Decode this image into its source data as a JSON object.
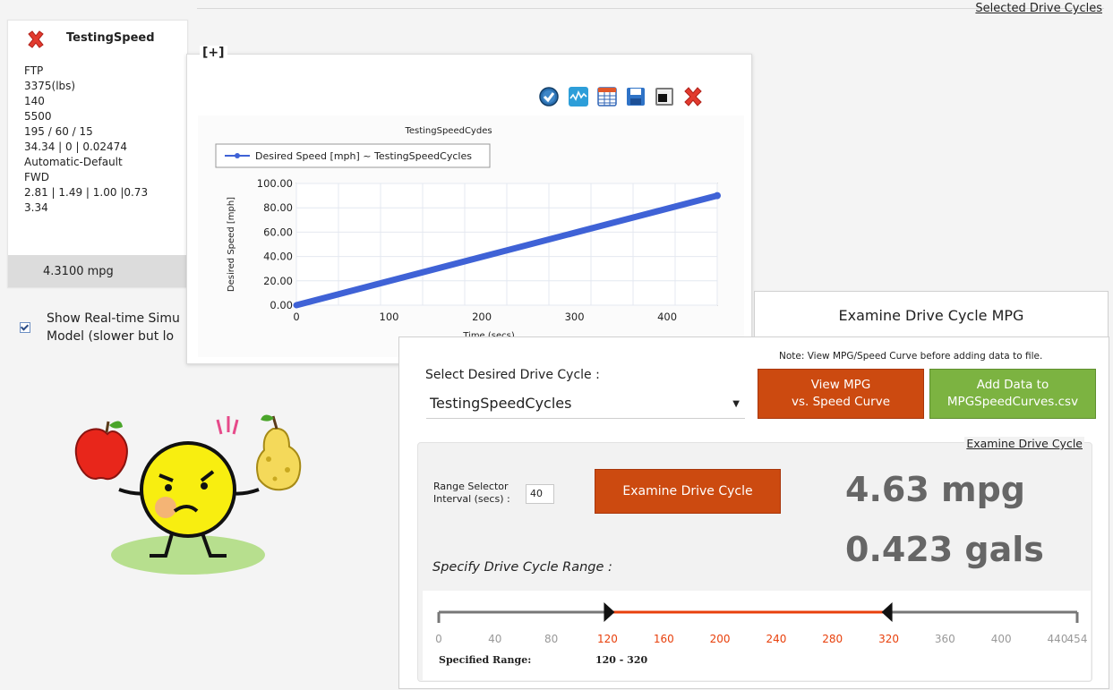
{
  "header": {
    "selected_drive_cycles": "Selected Drive Cycles"
  },
  "card": {
    "name": "TestingSpeed",
    "specs": [
      "FTP",
      "3375(lbs)",
      "140",
      "5500",
      "195 / 60 / 15",
      "34.34 | 0 | 0.02474",
      "Automatic-Default",
      "FWD",
      "2.81 | 1.49 | 1.00 |0.73",
      "3.34"
    ],
    "mpg": "4.3100 mpg"
  },
  "realtime": {
    "checked": true,
    "line1": "Show Real-time Simu",
    "line2": "Model (slower but lo"
  },
  "popup": {
    "expand": "[+]",
    "toolbar": [
      "check-icon",
      "wave-chart-icon",
      "table-icon",
      "save-icon",
      "window-icon",
      "close-icon"
    ]
  },
  "chart_data": {
    "type": "line",
    "title": "TestingSpeedCydes",
    "legend": "Desired Speed [mph] ~ TestingSpeedCycles",
    "legend_position": "top-left",
    "xlabel": "Time (secs)",
    "ylabel": "Desired Speed [mph]",
    "xlim": [
      0,
      454
    ],
    "ylim": [
      0,
      100
    ],
    "xticks": [
      0,
      100,
      200,
      300,
      400
    ],
    "yticks": [
      "0.00",
      "20.00",
      "40.00",
      "60.00",
      "80.00",
      "100.00"
    ],
    "grid": true,
    "series": [
      {
        "name": "Desired Speed [mph] ~ TestingSpeedCycles",
        "color": "#3f62d6",
        "x_start": 0,
        "x_end": 454,
        "y_start": 0,
        "y_end": 90
      }
    ]
  },
  "mpg_panel": {
    "tab_title": "Examine Drive Cycle MPG",
    "note": "Note: View MPG/Speed Curve before adding data to file.",
    "select_label": "Select Desired Drive Cycle :",
    "select_value": "TestingSpeedCycles",
    "view_btn": [
      "View MPG",
      "vs. Speed Curve"
    ],
    "add_btn": [
      "Add Data to",
      "MPGSpeedCurves.csv"
    ],
    "examine_title": "Examine Drive Cycle",
    "range_label": [
      "Range Selector",
      "Interval (secs) :"
    ],
    "range_value": "40",
    "examine_btn": "Examine Drive Cycle",
    "mpg": "4.63 mpg",
    "gals": "0.423 gals",
    "specify": "Specify Drive Cycle Range :",
    "slider": {
      "min": 0,
      "max": 454,
      "low": 120,
      "high": 320,
      "ticks": [
        "0",
        "40",
        "80",
        "120",
        "160",
        "200",
        "240",
        "280",
        "320",
        "360",
        "400",
        "440",
        "454"
      ],
      "active_color": "#e8400c",
      "inactive_color": "#777777"
    },
    "specified_label": "Specified Range:",
    "specified_value": "120 - 320"
  }
}
